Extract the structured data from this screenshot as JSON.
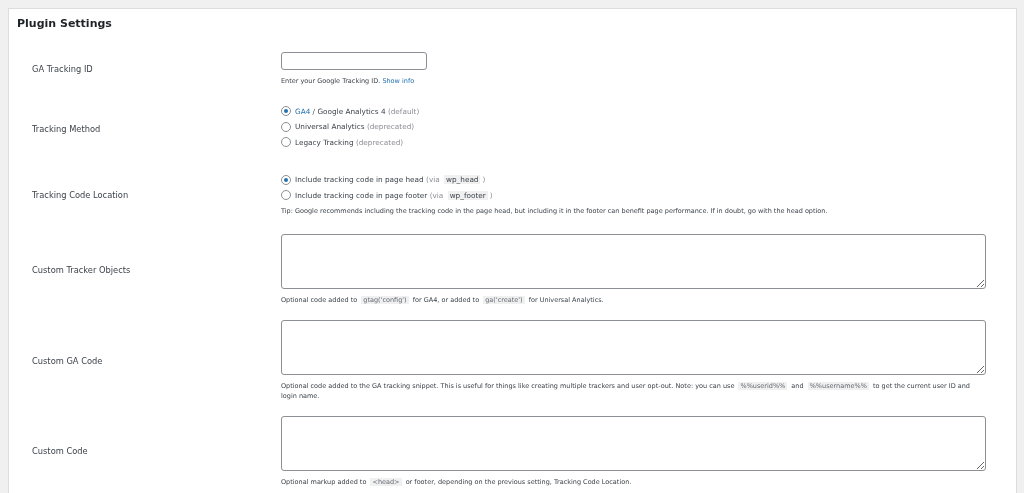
{
  "panel": {
    "title": "Plugin Settings"
  },
  "rows": [
    {
      "kind": "text",
      "label": "GA Tracking ID",
      "value": "",
      "description": [
        {
          "kind": "text",
          "text": "Enter your Google Tracking ID. "
        },
        {
          "kind": "link",
          "text": "Show info"
        }
      ]
    },
    {
      "kind": "radio",
      "label": "Tracking Method",
      "options": [
        {
          "selected": true,
          "parts": [
            {
              "kind": "link",
              "text": "GA4"
            },
            {
              "kind": "text",
              "text": " / Google Analytics 4 "
            },
            {
              "kind": "muted",
              "text": "(default)"
            }
          ]
        },
        {
          "selected": false,
          "parts": [
            {
              "kind": "text",
              "text": "Universal Analytics "
            },
            {
              "kind": "muted",
              "text": "(deprecated)"
            }
          ]
        },
        {
          "selected": false,
          "parts": [
            {
              "kind": "text",
              "text": "Legacy Tracking "
            },
            {
              "kind": "muted",
              "text": "(deprecated)"
            }
          ]
        }
      ]
    },
    {
      "kind": "radio",
      "label": "Tracking Code Location",
      "options": [
        {
          "selected": true,
          "parts": [
            {
              "kind": "text",
              "text": "Include tracking code in page head "
            },
            {
              "kind": "muted",
              "text": "(via "
            },
            {
              "kind": "code",
              "text": "wp_head"
            },
            {
              "kind": "muted",
              "text": ")"
            }
          ]
        },
        {
          "selected": false,
          "parts": [
            {
              "kind": "text",
              "text": "Include tracking code in page footer "
            },
            {
              "kind": "muted",
              "text": "(via "
            },
            {
              "kind": "code",
              "text": "wp_footer"
            },
            {
              "kind": "muted",
              "text": ")"
            }
          ]
        }
      ],
      "description": [
        {
          "kind": "text",
          "text": "Tip: Google recommends including the tracking code in the page head, but including it in the footer can benefit page performance. If in doubt, go with the head option."
        }
      ]
    },
    {
      "kind": "textarea",
      "label": "Custom Tracker Objects",
      "description": [
        {
          "kind": "text",
          "text": "Optional code added to "
        },
        {
          "kind": "code",
          "text": "gtag('config')"
        },
        {
          "kind": "text",
          "text": " for GA4, or added to "
        },
        {
          "kind": "code",
          "text": "ga('create')"
        },
        {
          "kind": "text",
          "text": " for Universal Analytics."
        }
      ]
    },
    {
      "kind": "textarea",
      "label": "Custom GA Code",
      "description": [
        {
          "kind": "text",
          "text": "Optional code added to the GA tracking snippet. This is useful for things like creating multiple trackers and user opt-out. Note: you can use "
        },
        {
          "kind": "code",
          "text": "%%userid%%"
        },
        {
          "kind": "text",
          "text": " and "
        },
        {
          "kind": "code",
          "text": "%%username%%"
        },
        {
          "kind": "text",
          "text": " to get the current user ID and login name."
        }
      ]
    },
    {
      "kind": "textarea",
      "label": "Custom Code",
      "description": [
        {
          "kind": "text",
          "text": "Optional markup added to "
        },
        {
          "kind": "code",
          "text": "<head>"
        },
        {
          "kind": "text",
          "text": " or footer, depending on the previous setting, Tracking Code Location."
        }
      ]
    }
  ]
}
